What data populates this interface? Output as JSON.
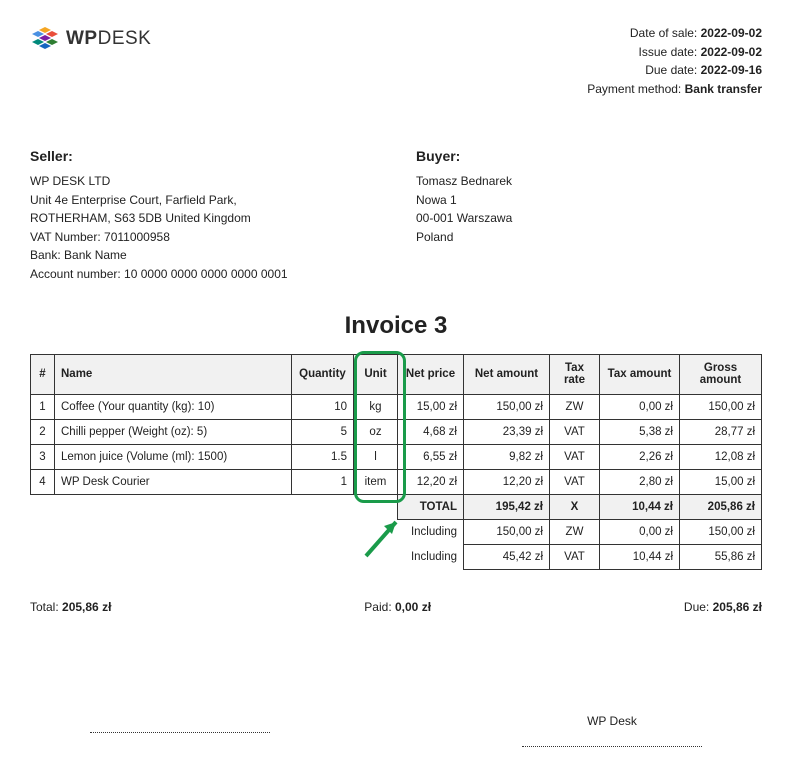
{
  "brand": {
    "name_bold": "WP",
    "name_rest": "DESK"
  },
  "meta": {
    "date_of_sale_label": "Date of sale:",
    "date_of_sale": "2022-09-02",
    "issue_date_label": "Issue date:",
    "issue_date": "2022-09-02",
    "due_date_label": "Due date:",
    "due_date": "2022-09-16",
    "payment_method_label": "Payment method:",
    "payment_method": "Bank transfer"
  },
  "seller": {
    "heading": "Seller:",
    "name": "WP DESK LTD",
    "address": "Unit 4e Enterprise Court, Farfield Park, ROTHERHAM, S63 5DB United Kingdom",
    "vat": "VAT Number: 7011000958",
    "bank": "Bank: Bank Name",
    "account": "Account number: 10 0000 0000 0000 0000 0001"
  },
  "buyer": {
    "heading": "Buyer:",
    "name": "Tomasz Bednarek",
    "line1": "Nowa 1",
    "line2": "00-001 Warszawa",
    "line3": "Poland"
  },
  "invoice_title": "Invoice 3",
  "columns": {
    "idx": "#",
    "name": "Name",
    "qty": "Quantity",
    "unit": "Unit",
    "net_price": "Net price",
    "net_amount": "Net amount",
    "tax_rate": "Tax rate",
    "tax_amount": "Tax amount",
    "gross_amount": "Gross amount"
  },
  "items": [
    {
      "idx": "1",
      "name": "Coffee (Your quantity (kg): 10)",
      "qty": "10",
      "unit": "kg",
      "net_price": "15,00 zł",
      "net_amount": "150,00 zł",
      "tax_rate": "ZW",
      "tax_amount": "0,00 zł",
      "gross_amount": "150,00 zł"
    },
    {
      "idx": "2",
      "name": "Chilli pepper (Weight (oz): 5)",
      "qty": "5",
      "unit": "oz",
      "net_price": "4,68 zł",
      "net_amount": "23,39 zł",
      "tax_rate": "VAT",
      "tax_amount": "5,38 zł",
      "gross_amount": "28,77 zł"
    },
    {
      "idx": "3",
      "name": "Lemon juice (Volume (ml): 1500)",
      "qty": "1.5",
      "unit": "l",
      "net_price": "6,55 zł",
      "net_amount": "9,82 zł",
      "tax_rate": "VAT",
      "tax_amount": "2,26 zł",
      "gross_amount": "12,08 zł"
    },
    {
      "idx": "4",
      "name": "WP Desk Courier",
      "qty": "1",
      "unit": "item",
      "net_price": "12,20 zł",
      "net_amount": "12,20 zł",
      "tax_rate": "VAT",
      "tax_amount": "2,80 zł",
      "gross_amount": "15,00 zł"
    }
  ],
  "totals": {
    "total_label": "TOTAL",
    "net_amount": "195,42 zł",
    "tax_rate": "X",
    "tax_amount": "10,44 zł",
    "gross_amount": "205,86 zł",
    "including_label": "Including",
    "breakdown": [
      {
        "net_amount": "150,00 zł",
        "tax_rate": "ZW",
        "tax_amount": "0,00 zł",
        "gross_amount": "150,00 zł"
      },
      {
        "net_amount": "45,42 zł",
        "tax_rate": "VAT",
        "tax_amount": "10,44 zł",
        "gross_amount": "55,86 zł"
      }
    ]
  },
  "footer": {
    "total_label": "Total:",
    "total_val": "205,86 zł",
    "paid_label": "Paid:",
    "paid_val": "0,00 zł",
    "due_label": "Due:",
    "due_val": "205,86 zł"
  },
  "signatures": {
    "left": "",
    "right": "WP Desk"
  }
}
